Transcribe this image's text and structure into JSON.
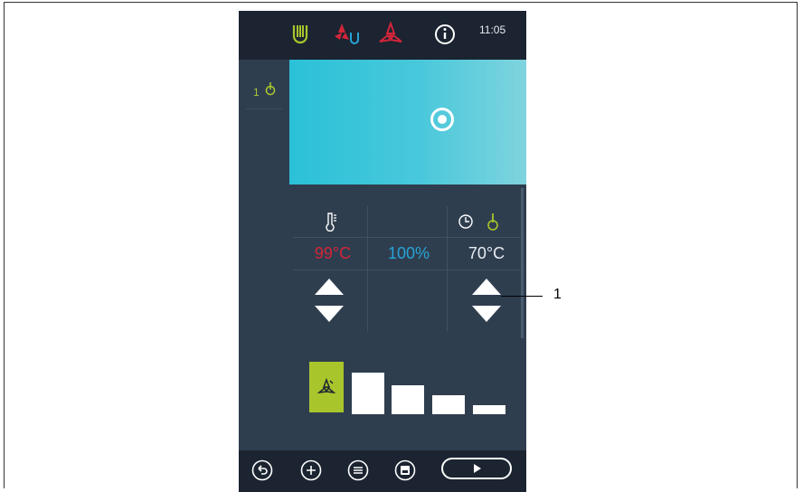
{
  "topbar": {
    "icons": [
      "hot-air-icon",
      "combi-steam-icon",
      "fan-icon",
      "info-icon"
    ],
    "clock": "11:05"
  },
  "sidepanel": {
    "item_number": "1",
    "icon": "core-probe-icon"
  },
  "controls": {
    "temperature": {
      "icon": "thermometer-icon",
      "value": "99°C",
      "color": "#d2253a"
    },
    "humidity": {
      "value": "100%",
      "color": "#27a3d6"
    },
    "core": {
      "icons": [
        "timer-icon",
        "core-probe-icon"
      ],
      "value": "70°C",
      "color": "#e8edf2"
    }
  },
  "fan_speed": {
    "levels": 5,
    "selected": 1,
    "icon": "fan-icon"
  },
  "bottombar": {
    "buttons": [
      "back-icon",
      "add-icon",
      "list-icon",
      "save-icon",
      "play-icon"
    ]
  },
  "callout": {
    "label": "1"
  },
  "colors": {
    "accent_green": "#a9c52c",
    "chamber": "#2ac1d8",
    "red": "#d2253a"
  }
}
